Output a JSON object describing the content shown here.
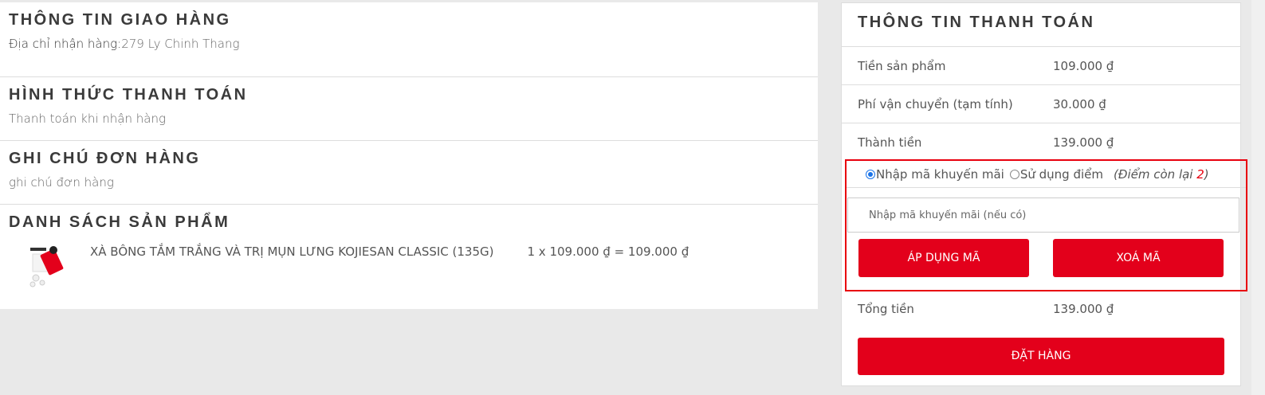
{
  "shipping": {
    "title": "THÔNG TIN GIAO HÀNG",
    "address_label": "Địa chỉ nhận hàng:",
    "address_value": "279 Ly Chinh Thang"
  },
  "payment_method": {
    "title": "HÌNH THỨC THANH TOÁN",
    "value": "Thanh toán khi nhận hàng"
  },
  "order_note": {
    "title": "GHI CHÚ ĐƠN HÀNG",
    "value": "ghi chú đơn hàng"
  },
  "product_list": {
    "title": "DANH SÁCH SẢN PHẨM",
    "items": [
      {
        "name": "XÀ BÔNG TẮM TRẮNG VÀ TRỊ MỤN LƯNG KOJIESAN CLASSIC (135G)",
        "price_line": "1 x 109.000 ₫ = 109.000 ₫"
      }
    ]
  },
  "summary": {
    "title": "THÔNG TIN THANH TOÁN",
    "rows": [
      {
        "label": "Tiền sản phẩm",
        "value": "109.000 ₫"
      },
      {
        "label": "Phí vận chuyển (tạm tính)",
        "value": "30.000 ₫"
      },
      {
        "label": "Thành tiền",
        "value": "139.000 ₫"
      }
    ],
    "promo": {
      "option_code": "Nhập mã khuyến mãi",
      "option_points": "Sử dụng điểm",
      "points_note_prefix": "(Điểm còn lại ",
      "points_remaining": "2",
      "points_note_suffix": ")",
      "input_placeholder": "Nhập mã khuyến mãi (nếu có)",
      "apply_label": "ÁP DỤNG MÃ",
      "clear_label": "XOÁ MÃ"
    },
    "total": {
      "label": "Tổng tiền",
      "value": "139.000 ₫"
    },
    "order_label": "ĐẶT HÀNG"
  },
  "colors": {
    "accent": "#e3001b",
    "highlight_border": "#e8000e",
    "radio": "#1a73e8"
  }
}
